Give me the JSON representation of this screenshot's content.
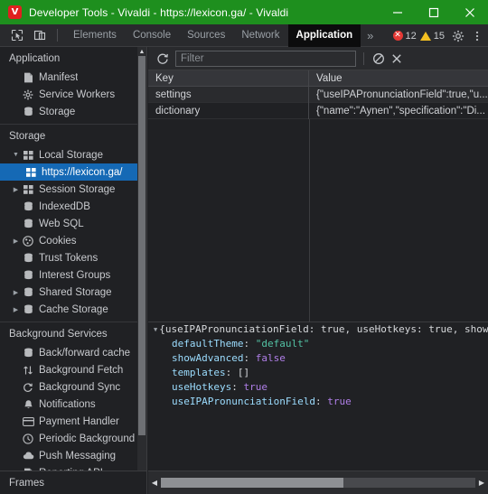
{
  "window": {
    "title": "Developer Tools - Vivaldi - https://lexicon.ga/ - Vivaldi",
    "logo_letter": "V",
    "minimize_label": "Minimize",
    "maximize_label": "Maximize",
    "close_label": "Close",
    "titlebar_color": "#1e8f1e",
    "logo_color": "#e02020"
  },
  "toolbar": {
    "inspect_icon": "inspect-element-icon",
    "device_icon": "device-toolbar-icon",
    "tabs": [
      {
        "label": "Elements",
        "selected": false
      },
      {
        "label": "Console",
        "selected": false
      },
      {
        "label": "Sources",
        "selected": false
      },
      {
        "label": "Network",
        "selected": false
      },
      {
        "label": "Application",
        "selected": true
      }
    ],
    "more_tabs_label": "»",
    "errors_count": "12",
    "warnings_count": "15",
    "error_color": "#e53935",
    "warning_color": "#f4c021",
    "settings_icon": "gear-icon",
    "menu_icon": "kebab-menu-icon"
  },
  "sidebar": {
    "sections": [
      {
        "title": "Application",
        "items": [
          {
            "label": "Manifest",
            "icon": "manifest-document-icon",
            "indent": 1,
            "arrow": "",
            "selected": false
          },
          {
            "label": "Service Workers",
            "icon": "gear-icon",
            "indent": 1,
            "arrow": "",
            "selected": false
          },
          {
            "label": "Storage",
            "icon": "database-icon",
            "indent": 1,
            "arrow": "",
            "selected": false
          }
        ]
      },
      {
        "title": "Storage",
        "items": [
          {
            "label": "Local Storage",
            "icon": "table-grid-icon",
            "indent": 1,
            "arrow": "▼",
            "selected": false
          },
          {
            "label": "https://lexicon.ga/",
            "icon": "table-grid-icon",
            "indent": 2,
            "arrow": "",
            "selected": true
          },
          {
            "label": "Session Storage",
            "icon": "table-grid-icon",
            "indent": 1,
            "arrow": "▶",
            "selected": false
          },
          {
            "label": "IndexedDB",
            "icon": "database-icon",
            "indent": 1,
            "arrow": "",
            "selected": false
          },
          {
            "label": "Web SQL",
            "icon": "database-icon",
            "indent": 1,
            "arrow": "",
            "selected": false
          },
          {
            "label": "Cookies",
            "icon": "cookie-icon",
            "indent": 1,
            "arrow": "▶",
            "selected": false
          },
          {
            "label": "Trust Tokens",
            "icon": "database-icon",
            "indent": 1,
            "arrow": "",
            "selected": false
          },
          {
            "label": "Interest Groups",
            "icon": "database-icon",
            "indent": 1,
            "arrow": "",
            "selected": false
          },
          {
            "label": "Shared Storage",
            "icon": "database-icon",
            "indent": 1,
            "arrow": "▶",
            "selected": false
          },
          {
            "label": "Cache Storage",
            "icon": "database-icon",
            "indent": 1,
            "arrow": "▶",
            "selected": false
          }
        ]
      },
      {
        "title": "Background Services",
        "items": [
          {
            "label": "Back/forward cache",
            "icon": "database-icon",
            "indent": 1,
            "arrow": "",
            "selected": false
          },
          {
            "label": "Background Fetch",
            "icon": "arrows-updown-icon",
            "indent": 1,
            "arrow": "",
            "selected": false
          },
          {
            "label": "Background Sync",
            "icon": "sync-refresh-icon",
            "indent": 1,
            "arrow": "",
            "selected": false
          },
          {
            "label": "Notifications",
            "icon": "bell-icon",
            "indent": 1,
            "arrow": "",
            "selected": false
          },
          {
            "label": "Payment Handler",
            "icon": "credit-card-icon",
            "indent": 1,
            "arrow": "",
            "selected": false
          },
          {
            "label": "Periodic Background Sync",
            "icon": "clock-icon",
            "indent": 1,
            "arrow": "",
            "selected": false
          },
          {
            "label": "Push Messaging",
            "icon": "cloud-icon",
            "indent": 1,
            "arrow": "",
            "selected": false
          },
          {
            "label": "Reporting API",
            "icon": "document-icon",
            "indent": 1,
            "arrow": "",
            "selected": false
          }
        ]
      }
    ],
    "frames_label": "Frames",
    "frames_arrow": "▼",
    "selected_color": "#1569b5"
  },
  "filterbar": {
    "refresh_icon": "refresh-icon",
    "filter_placeholder": "Filter",
    "filter_value": "",
    "clear_icon": "no-entry-clear-icon",
    "delete_icon": "x-close-icon"
  },
  "table": {
    "columns": [
      "Key",
      "Value"
    ],
    "rows": [
      {
        "key": "settings",
        "value": "{\"useIPAPronunciationField\":true,\"u..."
      },
      {
        "key": "dictionary",
        "value": "{\"name\":\"Aynen\",\"specification\":\"Di..."
      }
    ]
  },
  "preview": {
    "expander": "▼",
    "root_line": "{useIPAPronunciationField: true, useHotkeys: true, showAdvance",
    "properties": [
      {
        "name": "defaultTheme",
        "value": "\"default\"",
        "kind": "string"
      },
      {
        "name": "showAdvanced",
        "value": "false",
        "kind": "boolean"
      },
      {
        "name": "templates",
        "value": "[]",
        "kind": "array"
      },
      {
        "name": "useHotkeys",
        "value": "true",
        "kind": "boolean"
      },
      {
        "name": "useIPAPronunciationField",
        "value": "true",
        "kind": "boolean"
      }
    ],
    "string_color": "#53c2a4",
    "boolean_color": "#b07fe8",
    "name_color": "#9bdcfe"
  },
  "scrollbars": {
    "sidebar_up_arrow": "▲",
    "sidebar_down_arrow": "▼",
    "h_left_arrow": "◀",
    "h_right_arrow": "▶"
  }
}
